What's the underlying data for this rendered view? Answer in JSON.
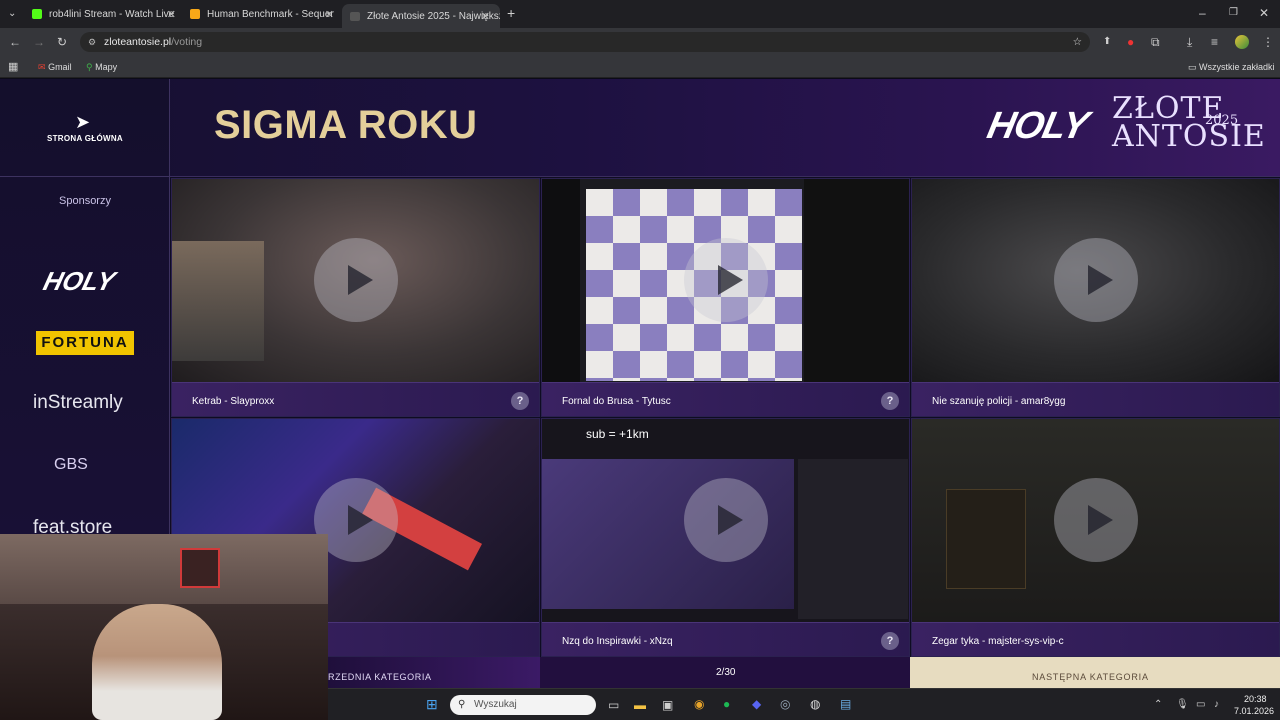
{
  "browser": {
    "tabs": [
      {
        "title": "rob4lini Stream - Watch Live on",
        "color": "#53fc18"
      },
      {
        "title": "Human Benchmark - Sequence",
        "color": "#f8a818"
      },
      {
        "title": "Złote Antosie 2025 - Największ",
        "color": "#444444"
      }
    ],
    "url_domain": "zloteantosie.pl",
    "url_path": "/voting",
    "bookmarks": [
      "Gmail",
      "Mapy"
    ],
    "all_bookmarks": "Wszystkie zakładki"
  },
  "page": {
    "home_label": "STRONA GŁÓWNA",
    "title": "SIGMA ROKU",
    "logo_holy": "HOLY",
    "logo_line1": "ZŁOTE",
    "logo_line2": "ANTOSIE",
    "logo_year": "2025",
    "sponsors_title": "Sponsorzy",
    "sponsors": [
      "HOLY",
      "FORTUNA",
      "inStreamly",
      "GBS",
      "feat.store"
    ],
    "help": "?",
    "videos": [
      {
        "title": "Ketrab - Slayproxx"
      },
      {
        "title": "Fornal do Brusa - Tytusc"
      },
      {
        "title": "Nie szanuję policji - amar8ygg"
      },
      {
        "title": ""
      },
      {
        "title": "Nzq do Inspirawki - xNzq",
        "overlay": "sub = +1km"
      },
      {
        "title": "Zegar tyka - majster-sys-vip-c"
      }
    ],
    "prev_label": "RZEDNIA KATEGORIA",
    "pager": "2/30",
    "next_label": "NASTĘPNA KATEGORIA"
  },
  "taskbar": {
    "search_placeholder": "Wyszukaj",
    "time": "20:38",
    "date": "7.01.2026"
  }
}
